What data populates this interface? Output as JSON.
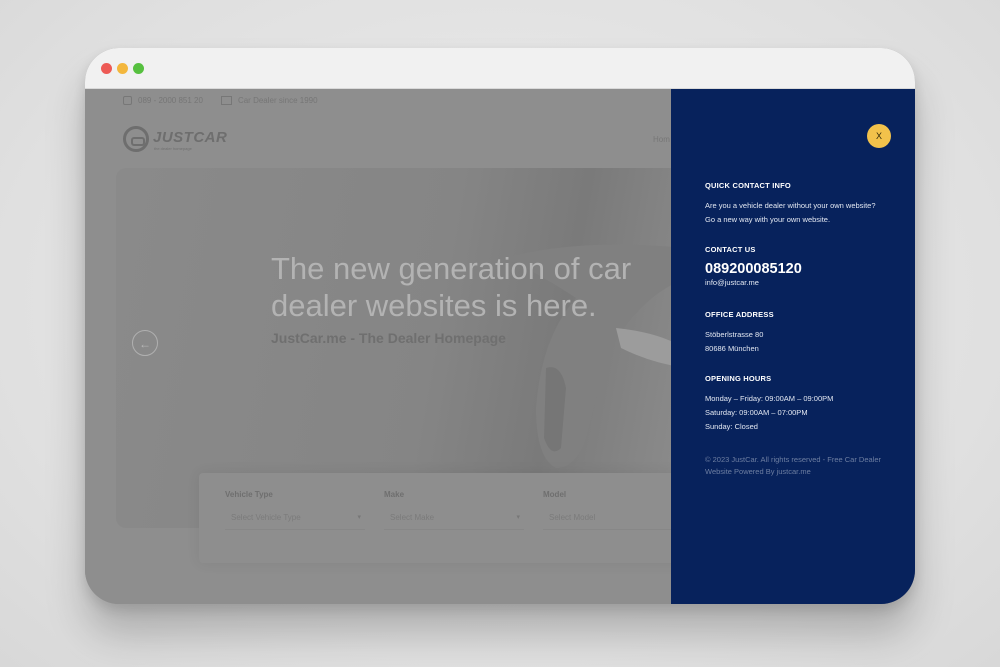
{
  "topbar": {
    "phone": "089 - 2000 851 20",
    "tagline": "Car Dealer since 1990"
  },
  "logo": {
    "text": "JUSTCAR",
    "subtext": "the dealer homepage"
  },
  "nav": {
    "home": "Hom"
  },
  "hero": {
    "title": "The new generation of car dealer websites is here.",
    "subtitle": "JustCar.me - The Dealer Homepage",
    "prev_arrow": "←"
  },
  "search": {
    "fields": [
      {
        "label": "Vehicle Type",
        "placeholder": "Select Vehicle Type"
      },
      {
        "label": "Make",
        "placeholder": "Select Make"
      },
      {
        "label": "Model",
        "placeholder": "Select Model"
      }
    ]
  },
  "panel": {
    "close_label": "X",
    "quick_contact": {
      "heading": "QUICK CONTACT INFO",
      "line1": "Are you a vehicle dealer without your own website?",
      "line2": "Go a new way with your own website."
    },
    "contact": {
      "heading": "CONTACT US",
      "phone": "089200085120",
      "email": "info@justcar.me"
    },
    "office": {
      "heading": "OFFICE ADDRESS",
      "street": "Stöberlstrasse 80",
      "city": "80686 München"
    },
    "hours": {
      "heading": "OPENING HOURS",
      "weekdays": "Monday – Friday: 09:00AM – 09:00PM",
      "saturday": "Saturday: 09:00AM – 07:00PM",
      "sunday": "Sunday: Closed"
    },
    "copyright": "© 2023 JustCar. All rights reserved - Free Car Dealer Website Powered By justcar.me"
  },
  "colors": {
    "panel_bg": "#07225c",
    "close_button": "#f2c24b",
    "overlay": "#8e8e8e"
  },
  "icons": [
    "phone-icon",
    "map-icon",
    "logo-icon",
    "arrow-left-icon",
    "chevron-down-icon",
    "close-icon"
  ]
}
